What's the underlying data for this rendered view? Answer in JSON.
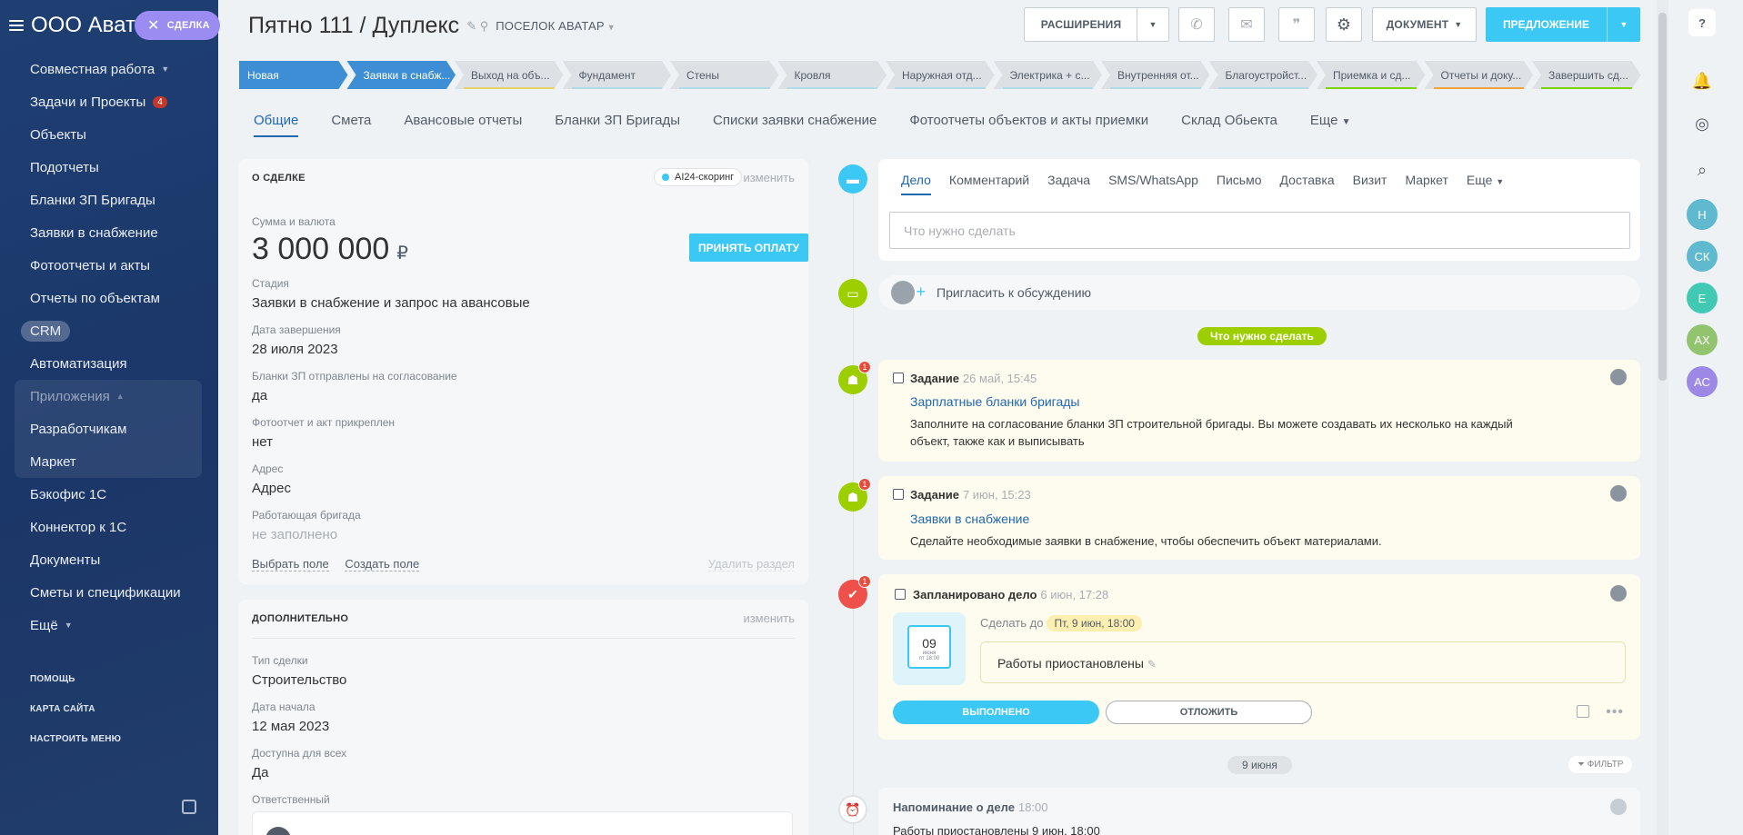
{
  "sidebar": {
    "company": "ООО Аватар",
    "deal_label": "СДЕЛКА",
    "items": [
      {
        "label": "Совместная работа",
        "caret": "⌵"
      },
      {
        "label": "Задачи и Проекты",
        "counter": "4"
      },
      {
        "label": "Объекты"
      },
      {
        "label": "Подотчеты"
      },
      {
        "label": "Бланки ЗП Бригады"
      },
      {
        "label": "Заявки в снабжение"
      },
      {
        "label": "Фотоотчеты и акты"
      },
      {
        "label": "Отчеты по объектам"
      },
      {
        "label": "CRM"
      },
      {
        "label": "Автоматизация"
      }
    ],
    "apps": {
      "title": "Приложения",
      "items": [
        "Разработчикам",
        "Маркет"
      ]
    },
    "items2": [
      "Бэкофис 1С",
      "Коннектор к 1С",
      "Документы",
      "Сметы и спецификации",
      "Ещё"
    ],
    "small": [
      "ПОМОЩЬ",
      "КАРТА САЙТА",
      "НАСТРОИТЬ МЕНЮ"
    ]
  },
  "header": {
    "title": "Пятно 111 / Дуплекс",
    "category": "Поселок Аватар",
    "extensions": "РАСШИРЕНИЯ",
    "document": "ДОКУМЕНТ",
    "proposal": "ПРЕДЛОЖЕНИЕ"
  },
  "stages": [
    {
      "label": "Новая",
      "done": true,
      "color": "#3d8ed4"
    },
    {
      "label": "Заявки в снабж...",
      "done": true,
      "color": "#3d8ed4"
    },
    {
      "label": "Выход на объ...",
      "done": false,
      "color": "#e8d36b"
    },
    {
      "label": "Фундамент",
      "done": false,
      "color": "#b0dce8"
    },
    {
      "label": "Стены",
      "done": false,
      "color": "#b0dce8"
    },
    {
      "label": "Кровля",
      "done": false,
      "color": "#b0dce8"
    },
    {
      "label": "Наружная отд...",
      "done": false,
      "color": "#b0dce8"
    },
    {
      "label": "Электрика + с...",
      "done": false,
      "color": "#b0dce8"
    },
    {
      "label": "Внутренняя от...",
      "done": false,
      "color": "#b0dce8"
    },
    {
      "label": "Благоустройст...",
      "done": false,
      "color": "#b0dce8"
    },
    {
      "label": "Приемка и сд...",
      "done": false,
      "color": "#7bd500"
    },
    {
      "label": "Отчеты и доку...",
      "done": false,
      "color": "#f2a33a"
    },
    {
      "label": "Завершить сд...",
      "done": false,
      "color": "#7bd500"
    }
  ],
  "tabs": [
    "Общие",
    "Смета",
    "Авансовые отчеты",
    "Бланки ЗП Бригады",
    "Списки заявки снабжение",
    "Фотоотчеты объектов и акты приемки",
    "Склад Обьекта",
    "Еще"
  ],
  "about": {
    "header": "О СДЕЛКЕ",
    "ai": "AI24-скоринг",
    "edit": "изменить",
    "amount_label": "Сумма и валюта",
    "amount": "3 000 000",
    "currency": "₽",
    "pay_button": "ПРИНЯТЬ ОПЛАТУ",
    "stage_label": "Стадия",
    "stage": "Заявки в снабжение и запрос на авансовые",
    "date_label": "Дата завершения",
    "date": "28 июля 2023",
    "zp_label": "Бланки ЗП отправлены на согласование",
    "zp": "да",
    "photo_label": "Фотоотчет и акт прикреплен",
    "photo": "нет",
    "addr_label": "Адрес",
    "addr": "Адрес",
    "brig_label": "Работающая бригада",
    "brig": "не заполнено",
    "choose": "Выбрать поле",
    "create": "Создать поле",
    "delete": "Удалить раздел"
  },
  "extra": {
    "header": "ДОПОЛНИТЕЛЬНО",
    "edit": "изменить",
    "type_label": "Тип сделки",
    "type": "Строительство",
    "start_label": "Дата начала",
    "start": "12 мая 2023",
    "avail_label": "Доступна для всех",
    "avail": "Да",
    "resp_label": "Ответственный"
  },
  "editor": {
    "tabs": [
      "Дело",
      "Комментарий",
      "Задача",
      "SMS/WhatsApp",
      "Письмо",
      "Доставка",
      "Визит",
      "Маркет",
      "Еще"
    ],
    "placeholder": "Что нужно сделать"
  },
  "invite": "Пригласить к обсуждению",
  "todo_header": "Что нужно сделать",
  "tasks": [
    {
      "title": "Задание",
      "date": "26 май, 15:45",
      "link": "Зарплатные бланки бригады",
      "text": "Заполните на согласование бланки ЗП строительной бригады. Вы можете создавать их несколько на каждый объект, также как и выписывать",
      "badge": "1"
    },
    {
      "title": "Задание",
      "date": "7 июн, 15:23",
      "link": "Заявки в снабжение",
      "text": "Сделайте необходимые заявки в снабжение, чтобы обеспечить объект материалами.",
      "badge": "1"
    }
  ],
  "planned": {
    "title": "Запланировано дело",
    "date": "6 июн, 17:28",
    "badge": "1",
    "cal_day": "09",
    "cal_month": "июня",
    "cal_sub": "пт 18:00",
    "deadline_label": "Сделать до",
    "deadline": "Пт, 9 июн, 18:00",
    "description": "Работы приостановлены",
    "done_button": "ВЫПОЛНЕНО",
    "postpone_button": "ОТЛОЖИТЬ"
  },
  "date_divider": "9 июня",
  "filter": "ФИЛЬТР",
  "reminder": {
    "title": "Напоминание о деле",
    "time": "18:00",
    "text": "Работы приостановлены 9 июн, 18:00"
  },
  "rightbar": {
    "avatars": [
      "Н",
      "СК",
      "Е",
      "АХ",
      "АС"
    ]
  }
}
